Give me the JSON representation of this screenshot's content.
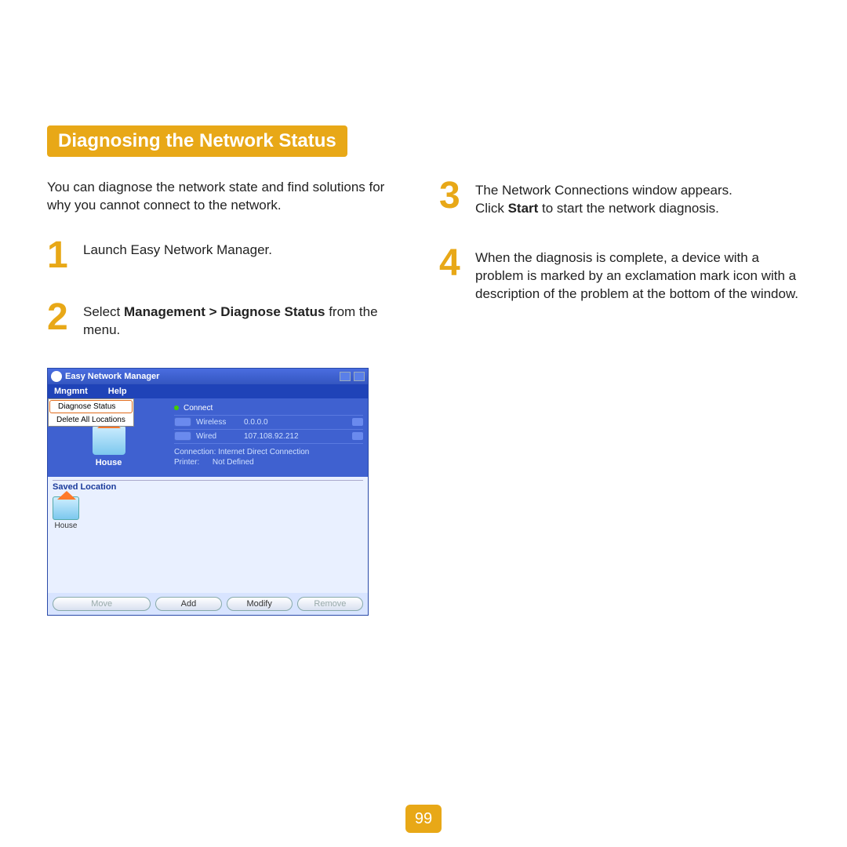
{
  "section_title": "Diagnosing the Network Status",
  "intro": "You can diagnose the network state and find solutions for why you cannot connect to the network.",
  "steps": {
    "1": {
      "num": "1",
      "text": "Launch Easy Network Manager."
    },
    "2": {
      "num": "2",
      "prefix": "Select ",
      "bold": "Management > Diagnose Status",
      "suffix": " from the menu."
    },
    "3": {
      "num": "3",
      "line1": "The Network Connections window appears.",
      "line2a": "Click ",
      "line2bold": "Start",
      "line2b": " to start the network diagnosis."
    },
    "4": {
      "num": "4",
      "text": "When the diagnosis is complete, a device with a problem is marked by an exclamation mark icon with a description of the problem at the bottom of the window."
    }
  },
  "enm": {
    "title": "Easy Network Manager",
    "menu": {
      "mngmnt": "Mngmnt",
      "help": "Help"
    },
    "dropdown": {
      "diagnose": "Diagnose Status",
      "delete": "Delete All Locations"
    },
    "house_label": "House",
    "connect": "Connect",
    "wireless_label": "Wireless",
    "wireless_val": "0.0.0.0",
    "wired_label": "Wired",
    "wired_val": "107.108.92.212",
    "conn_label": "Connection:",
    "conn_val": "Internet Direct Connection",
    "printer_label": "Printer:",
    "printer_val": "Not Defined",
    "saved_title": "Saved Location",
    "saved_item": "House",
    "btn_move": "Move",
    "btn_add": "Add",
    "btn_modify": "Modify",
    "btn_remove": "Remove"
  },
  "page_number": "99"
}
